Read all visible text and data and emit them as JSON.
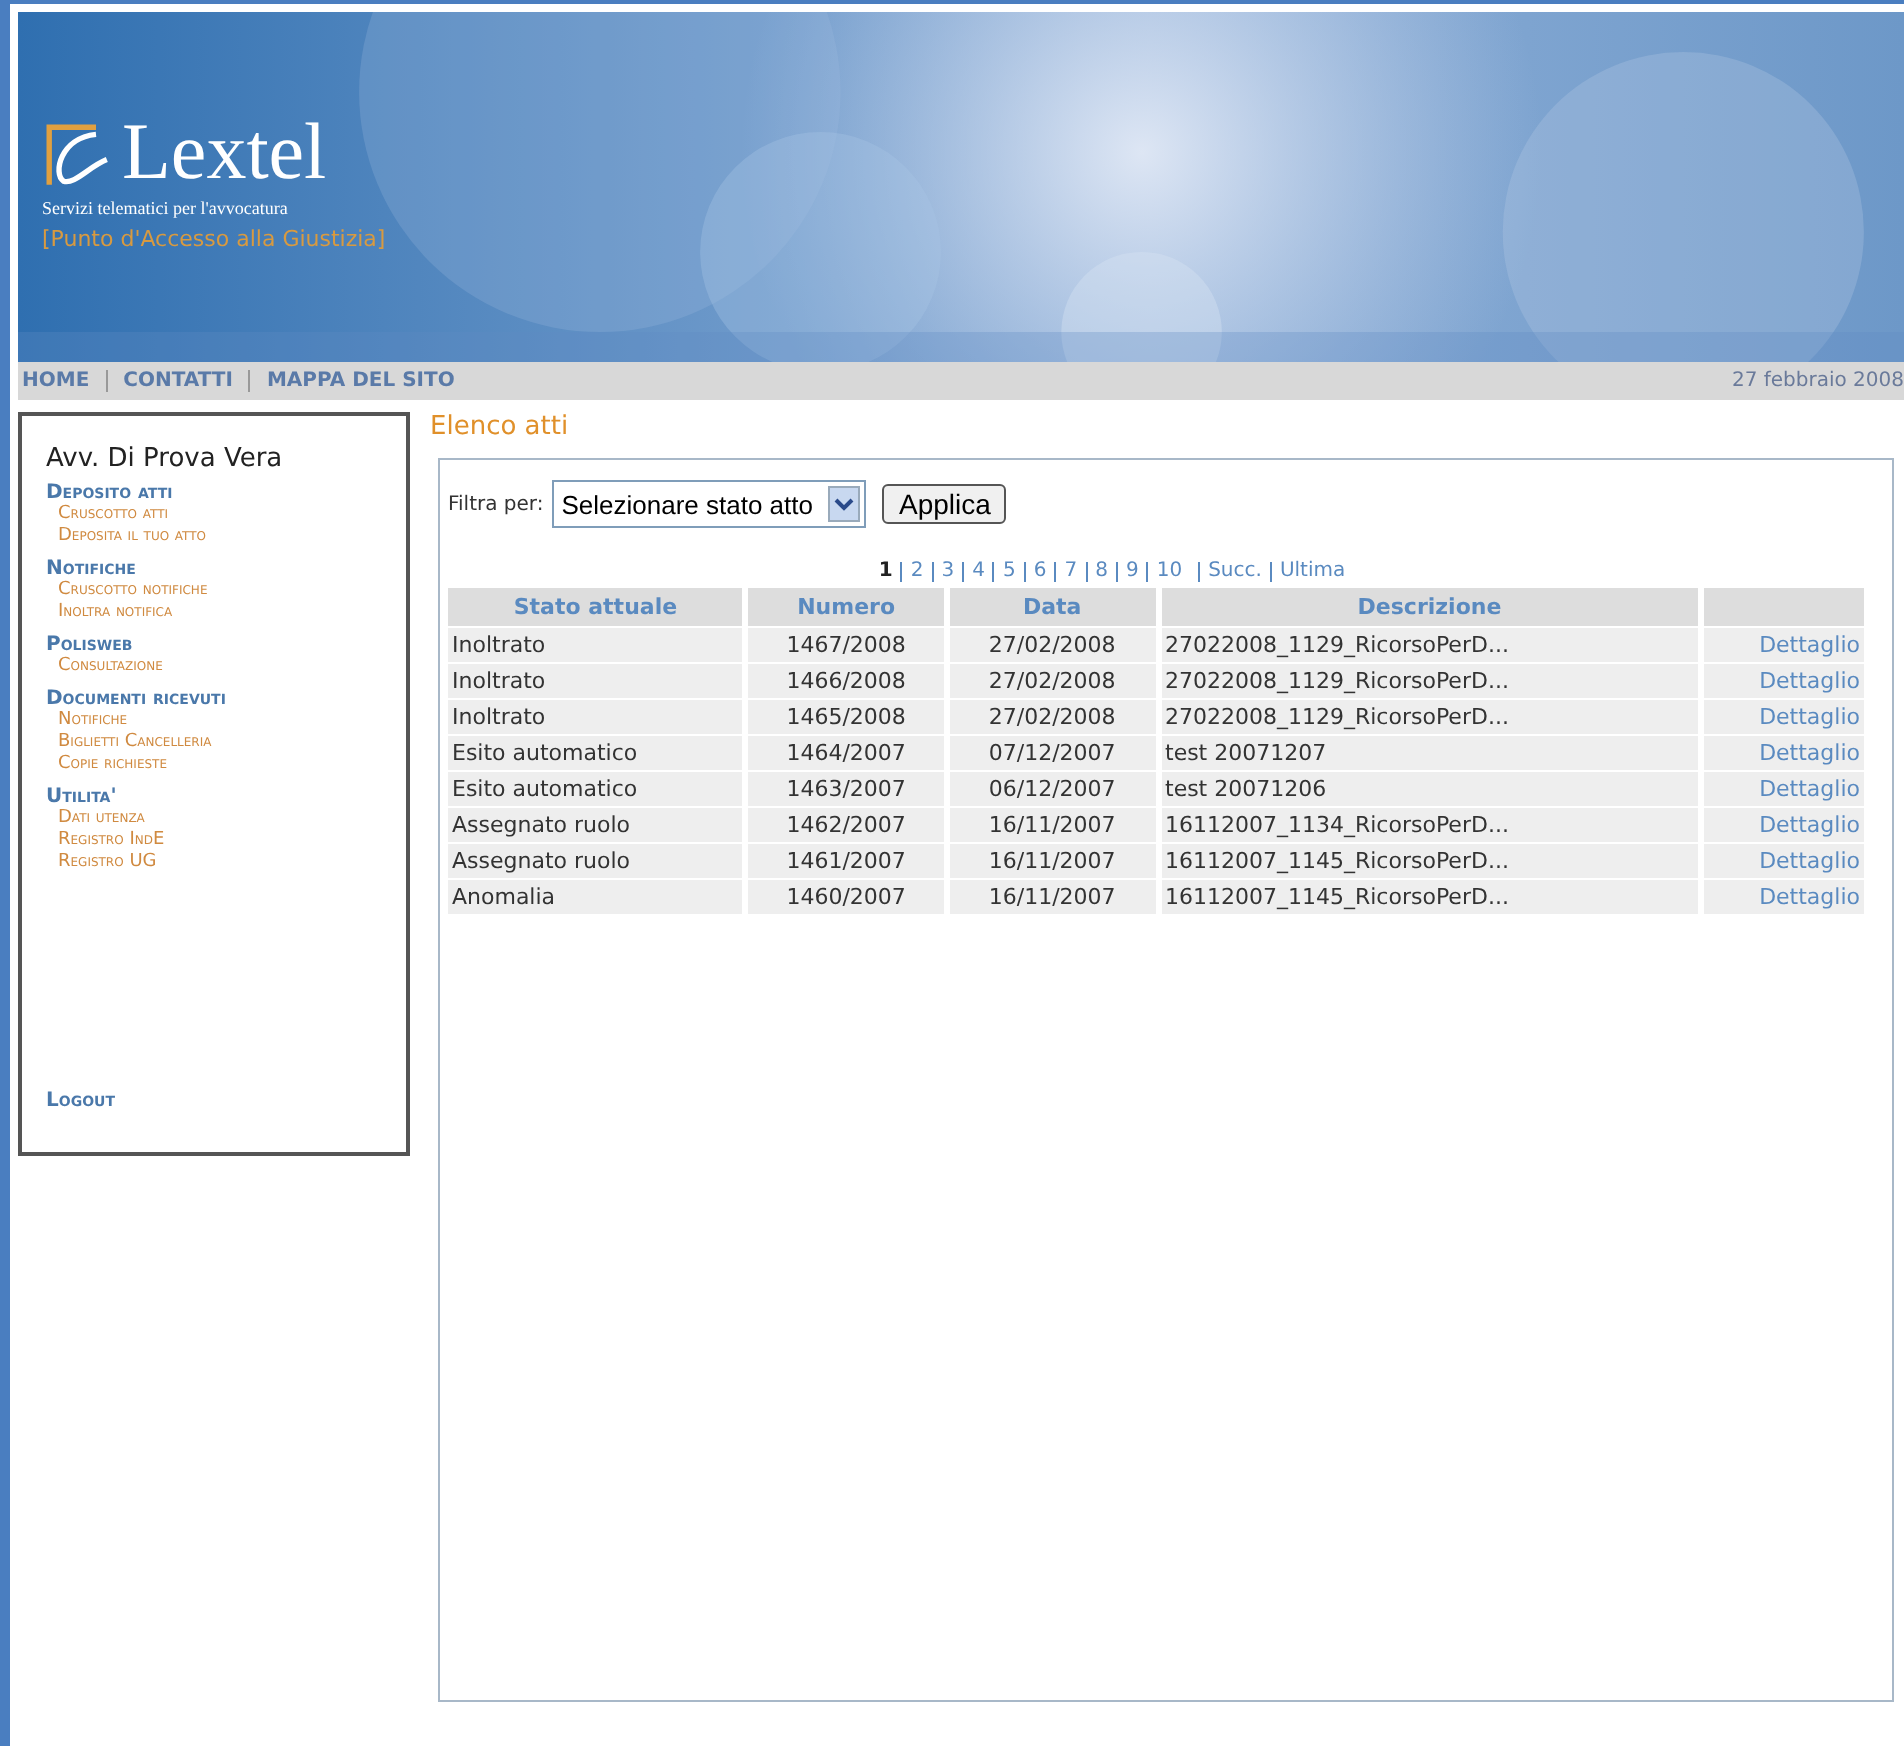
{
  "header": {
    "logo": "Lextel",
    "tagline": "Servizi telematici per l'avvocatura",
    "subtitle": "[Punto d'Accesso alla Giustizia]"
  },
  "nav": {
    "links": [
      "HOME",
      "CONTATTI",
      "MAPPA DEL SITO"
    ],
    "date": "27 febbraio 2008"
  },
  "sidebar": {
    "user": "Avv. Di Prova Vera",
    "sections": [
      {
        "title": "Deposito atti",
        "items": [
          "Cruscotto atti",
          "Deposita il tuo atto"
        ]
      },
      {
        "title": "Notifiche",
        "items": [
          "Cruscotto notifiche",
          "Inoltra notifica"
        ]
      },
      {
        "title": "Polisweb",
        "items": [
          "Consultazione"
        ]
      },
      {
        "title": "Documenti ricevuti",
        "items": [
          "Notifiche",
          "Biglietti Cancelleria",
          "Copie richieste"
        ]
      },
      {
        "title": "Utilita'",
        "items": [
          "Dati utenza",
          "Registro IndE",
          "Registro UG"
        ]
      }
    ],
    "logout": "Logout"
  },
  "main": {
    "title": "Elenco atti",
    "filter": {
      "label": "Filtra per:",
      "value": "Selezionare stato atto",
      "button": "Applica"
    },
    "pagination": {
      "pages": [
        {
          "label": "1",
          "selected": true
        },
        {
          "label": "2",
          "selected": false
        },
        {
          "label": "3",
          "selected": false
        },
        {
          "label": "4",
          "selected": false
        },
        {
          "label": "5",
          "selected": false
        },
        {
          "label": "6",
          "selected": false
        },
        {
          "label": "7",
          "selected": false
        },
        {
          "label": "8",
          "selected": false
        },
        {
          "label": "9",
          "selected": false
        },
        {
          "label": "10",
          "selected": false
        }
      ],
      "next": "Succ.",
      "last": "Ultima"
    },
    "table": {
      "columns": [
        "Stato attuale",
        "Numero",
        "Data",
        "Descrizione"
      ],
      "rows": [
        {
          "stato": "Inoltrato",
          "numero": "1467/2008",
          "data": "27/02/2008",
          "descrizione": "27022008_1129_RicorsoPerD...",
          "link": "Dettaglio"
        },
        {
          "stato": "Inoltrato",
          "numero": "1466/2008",
          "data": "27/02/2008",
          "descrizione": "27022008_1129_RicorsoPerD...",
          "link": "Dettaglio"
        },
        {
          "stato": "Inoltrato",
          "numero": "1465/2008",
          "data": "27/02/2008",
          "descrizione": "27022008_1129_RicorsoPerD...",
          "link": "Dettaglio"
        },
        {
          "stato": "Esito automatico",
          "numero": "1464/2007",
          "data": "07/12/2007",
          "descrizione": "test 20071207",
          "link": "Dettaglio"
        },
        {
          "stato": "Esito automatico",
          "numero": "1463/2007",
          "data": "06/12/2007",
          "descrizione": "test 20071206",
          "link": "Dettaglio"
        },
        {
          "stato": "Assegnato ruolo",
          "numero": "1462/2007",
          "data": "16/11/2007",
          "descrizione": "16112007_1134_RicorsoPerD...",
          "link": "Dettaglio"
        },
        {
          "stato": "Assegnato ruolo",
          "numero": "1461/2007",
          "data": "16/11/2007",
          "descrizione": "16112007_1145_RicorsoPerD...",
          "link": "Dettaglio"
        },
        {
          "stato": "Anomalia",
          "numero": "1460/2007",
          "data": "16/11/2007",
          "descrizione": "16112007_1145_RicorsoPerD...",
          "link": "Dettaglio"
        }
      ]
    }
  }
}
